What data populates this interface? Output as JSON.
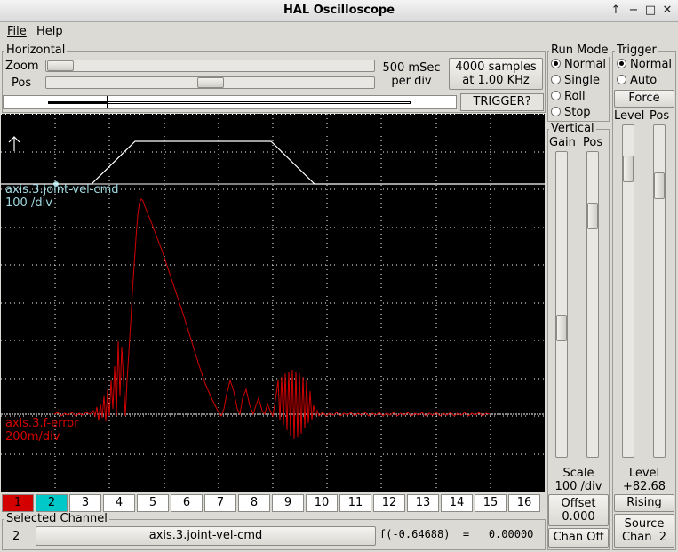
{
  "window": {
    "title": "HAL Oscilloscope",
    "buttons": [
      "↑",
      "−",
      "□",
      "✕"
    ]
  },
  "menu": {
    "file": "File",
    "help": "Help"
  },
  "horizontal": {
    "frame_label": "Horizontal",
    "zoom_label": "Zoom",
    "pos_label": "Pos",
    "rate_line1": "500 mSec",
    "rate_line2": "per div",
    "samples_line1": "4000 samples",
    "samples_line2": "at 1.00 KHz",
    "trigger_status": "TRIGGER?"
  },
  "run_mode": {
    "frame_label": "Run Mode",
    "options": [
      "Normal",
      "Single",
      "Roll",
      "Stop"
    ],
    "selected": "Normal"
  },
  "trigger": {
    "frame_label": "Trigger",
    "options": [
      "Normal",
      "Auto"
    ],
    "selected": "Normal",
    "force_label": "Force",
    "level_col": "Level",
    "pos_col": "Pos",
    "level_label": "Level",
    "level_value": "+82.68",
    "edge_button": "Rising",
    "source_line1": "Source",
    "source_line2": "Chan  2"
  },
  "vertical": {
    "frame_label": "Vertical",
    "gain_col": "Gain",
    "pos_col": "Pos",
    "scale_label": "Scale",
    "scale_value": "100 /div",
    "offset_line1": "Offset",
    "offset_line2": "0.000",
    "chan_off": "Chan Off"
  },
  "scope": {
    "trace1_name": "axis.3.joint-vel-cmd",
    "trace1_scale": "100 /div",
    "trace2_name": "axis.3.f-error",
    "trace2_scale": "200m/div",
    "trigger_marker": "↑"
  },
  "channels": {
    "labels": [
      "1",
      "2",
      "3",
      "4",
      "5",
      "6",
      "7",
      "8",
      "9",
      "10",
      "11",
      "12",
      "13",
      "14",
      "15",
      "16"
    ],
    "active": {
      "1": "#d40000",
      "2": "#00c8c8"
    }
  },
  "selected_channel": {
    "frame_label": "Selected Channel",
    "number": "2",
    "name": "axis.3.joint-vel-cmd",
    "readout": "f(-0.64688)  =   0.00000"
  },
  "colors": {
    "trace1": "#ffffff",
    "trace2": "#d40000",
    "trace1_label": "#9fd8e0",
    "grid": "#ffffff"
  }
}
